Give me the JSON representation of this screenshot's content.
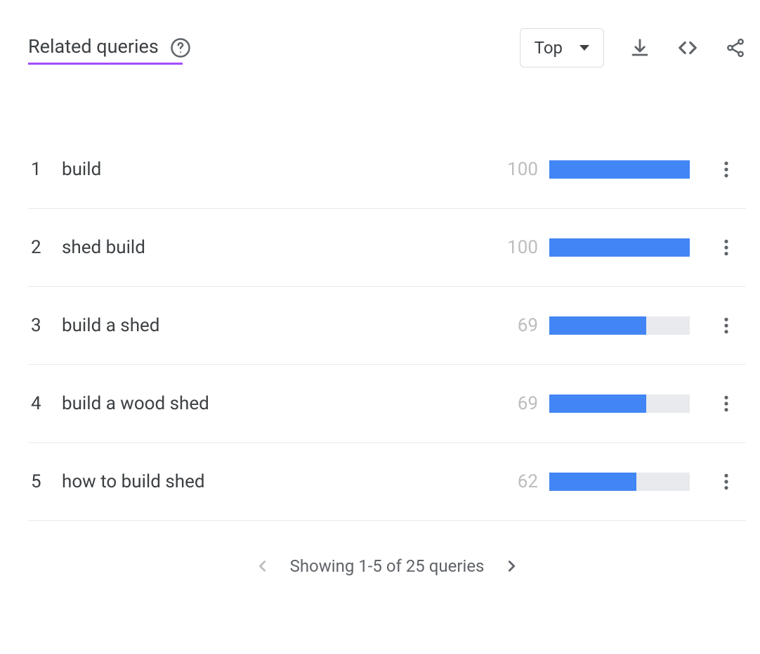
{
  "header": {
    "title": "Related queries",
    "dropdown_label": "Top"
  },
  "rows": [
    {
      "rank": "1",
      "query": "build",
      "value": "100",
      "pct": 100
    },
    {
      "rank": "2",
      "query": "shed build",
      "value": "100",
      "pct": 100
    },
    {
      "rank": "3",
      "query": "build a shed",
      "value": "69",
      "pct": 69
    },
    {
      "rank": "4",
      "query": "build a wood shed",
      "value": "69",
      "pct": 69
    },
    {
      "rank": "5",
      "query": "how to build shed",
      "value": "62",
      "pct": 62
    }
  ],
  "pagination": {
    "text": "Showing 1-5 of 25 queries"
  },
  "chart_data": {
    "type": "bar",
    "title": "Related queries",
    "categories": [
      "build",
      "shed build",
      "build a shed",
      "build a wood shed",
      "how to build shed"
    ],
    "values": [
      100,
      100,
      69,
      69,
      62
    ],
    "xlabel": "",
    "ylabel": "",
    "ylim": [
      0,
      100
    ]
  }
}
